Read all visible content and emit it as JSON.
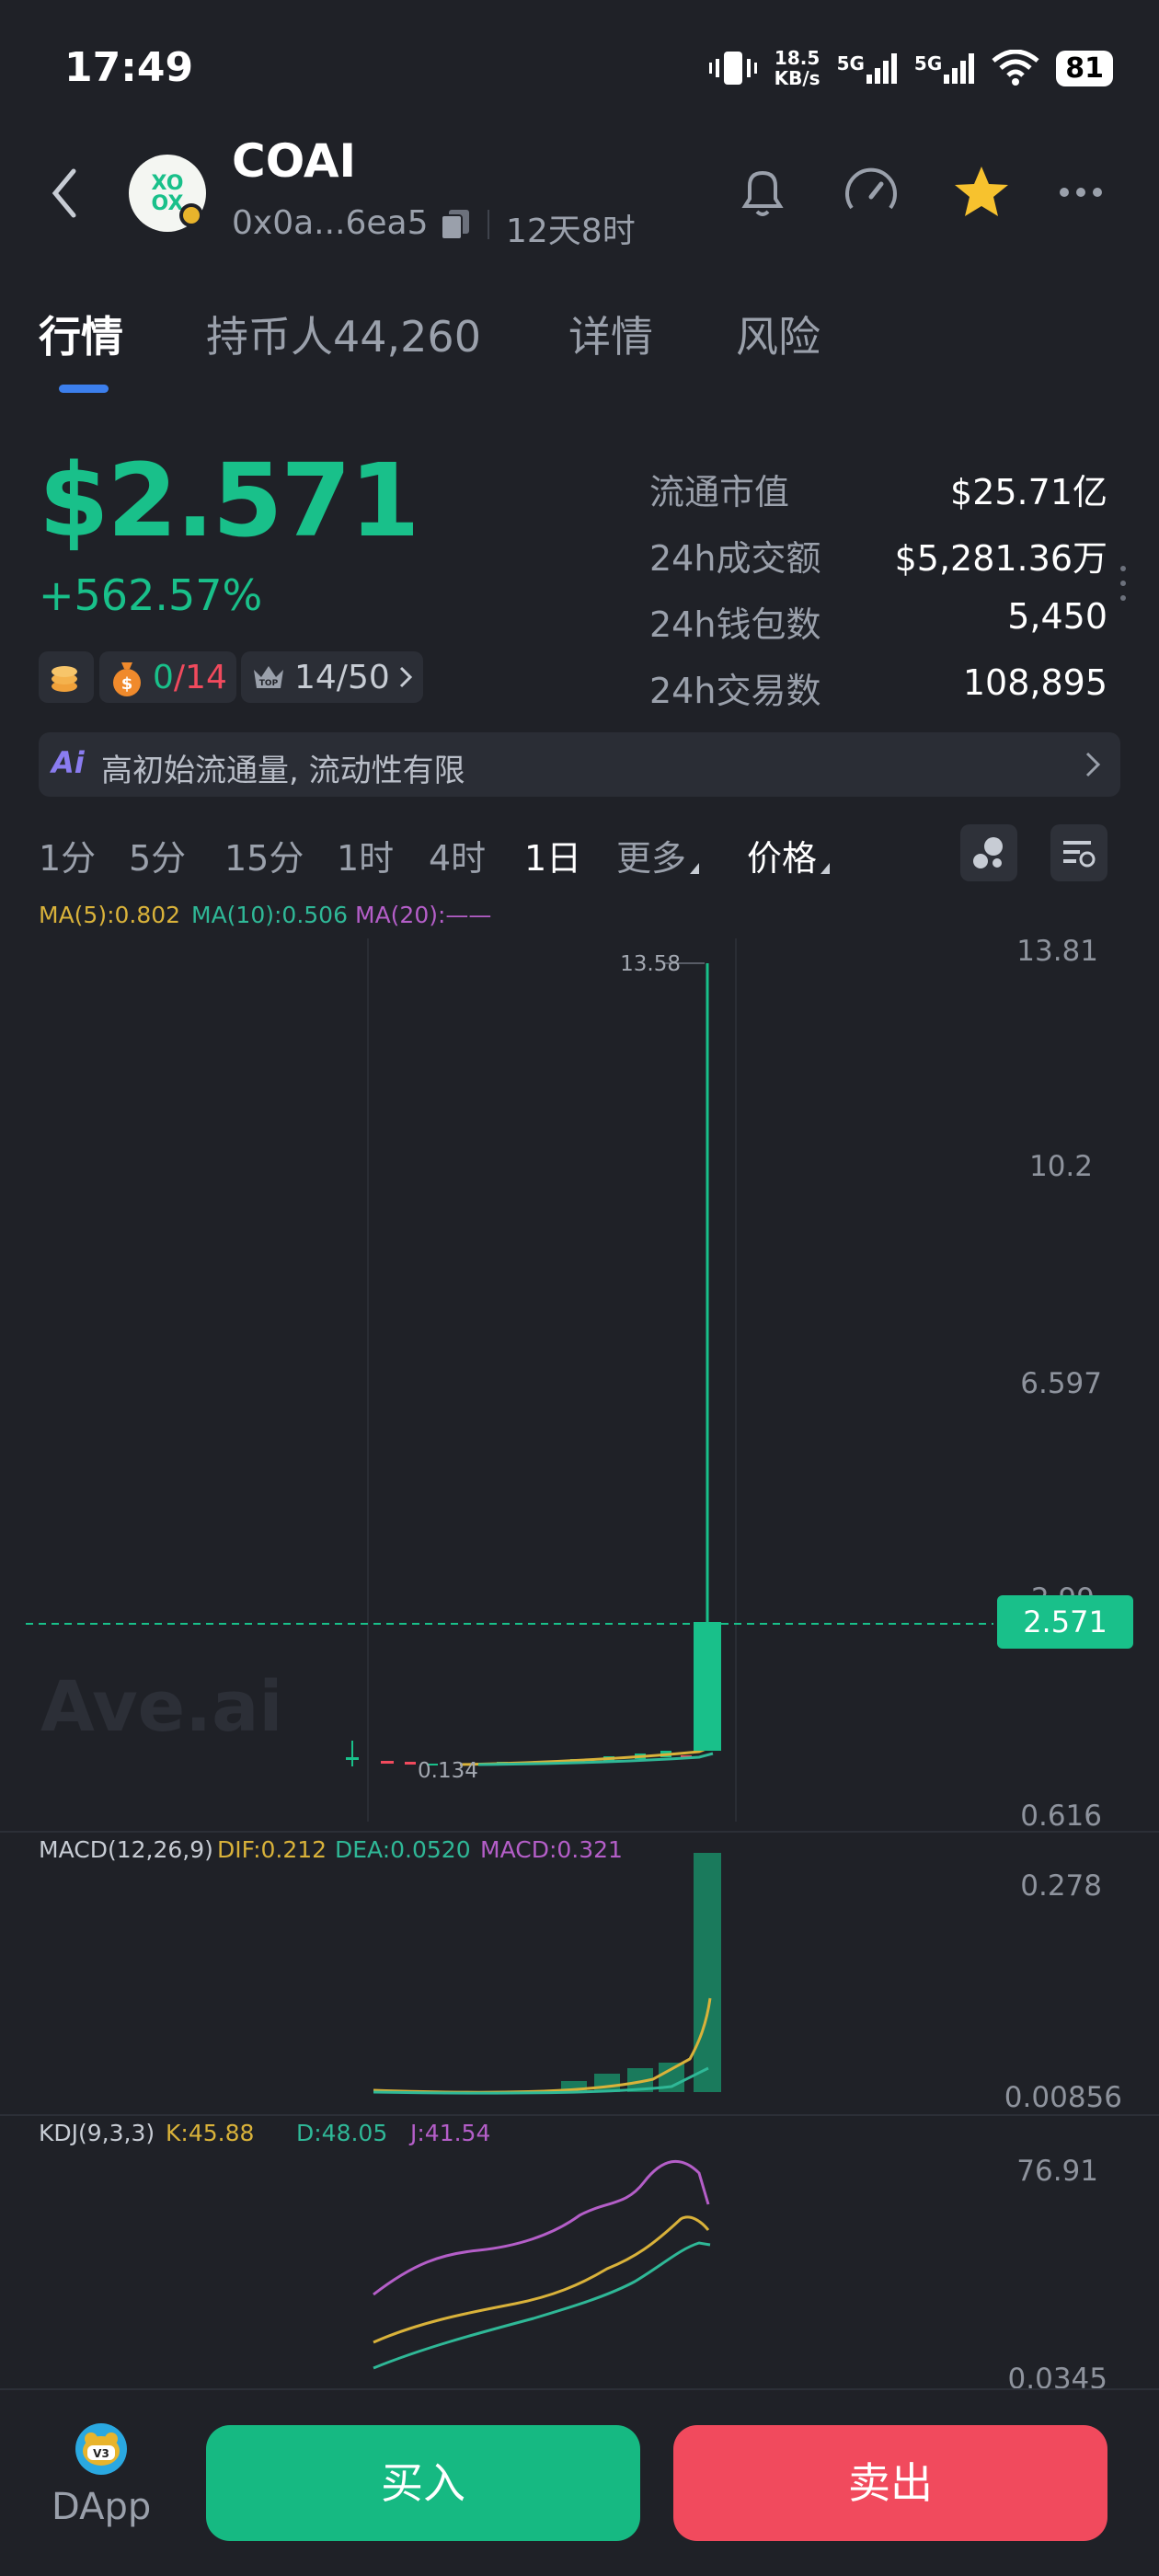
{
  "status": {
    "time": "17:49",
    "net_speed_value": "18.5",
    "net_speed_unit": "KB/s",
    "sig1": "5G",
    "sig2": "5G",
    "battery": "81"
  },
  "header": {
    "title": "COAI",
    "address": "0x0a...6ea5",
    "age": "12天8时"
  },
  "tabs": [
    {
      "label": "行情",
      "active": true
    },
    {
      "label": "持币人44,260"
    },
    {
      "label": "详情"
    },
    {
      "label": "风险"
    }
  ],
  "price": {
    "value": "$2.571",
    "change": "+562.57%"
  },
  "pills": {
    "tasks": "0",
    "tasks_total": "/14",
    "top": "14/50"
  },
  "stats": [
    {
      "label": "流通市值",
      "value": "$25.71亿"
    },
    {
      "label": "24h成交额",
      "value": "$5,281.36万"
    },
    {
      "label": "24h钱包数",
      "value": "5,450"
    },
    {
      "label": "24h交易数",
      "value": "108,895"
    }
  ],
  "ai_banner": {
    "icon": "Ai",
    "text": "高初始流通量, 流动性有限"
  },
  "timeframes": [
    {
      "label": "1分"
    },
    {
      "label": "5分"
    },
    {
      "label": "15分"
    },
    {
      "label": "1时"
    },
    {
      "label": "4时"
    },
    {
      "label": "1日",
      "active": true
    },
    {
      "label": "更多"
    },
    {
      "label": "价格"
    }
  ],
  "chart": {
    "ma_legend": {
      "ma5": "MA(5):0.802",
      "ma10": "MA(10):0.506",
      "ma20": "MA(20):——"
    },
    "axis": {
      "y1": "13.81",
      "y2": "10.2",
      "y3": "6.597",
      "y4": "2.99",
      "y5": "0.616"
    },
    "high_label": "13.58",
    "low_label": "0.134",
    "current_price": "2.571",
    "watermark": "Ave.ai",
    "macd_legend": {
      "name": "MACD(12,26,9)",
      "dif": "DIF:0.212",
      "dea": "DEA:0.0520",
      "macd": "MACD:0.321"
    },
    "macd_axis": {
      "top": "0.278",
      "bottom": "0.00856"
    },
    "kdj_legend": {
      "name": "KDJ(9,3,3)",
      "k": "K:45.88",
      "d": "D:48.05",
      "j": "J:41.54"
    },
    "kdj_axis": {
      "top": "76.91",
      "bottom": "0.0345"
    }
  },
  "chart_data": {
    "type": "candlestick",
    "y_range": [
      0.616,
      13.81
    ],
    "last_candle": {
      "open": 0.9,
      "close": 2.571,
      "high": 13.58,
      "low": 0.616
    },
    "min_low": 0.134,
    "colors": {
      "up": "#19c08a",
      "down": "#f14a5d",
      "ma5": "#d9b23a",
      "ma10": "#2fb897",
      "ma20": "#b45ec8"
    }
  },
  "bottom": {
    "dapp_badge": "V3",
    "dapp_label": "DApp",
    "buy": "买入",
    "sell": "卖出"
  }
}
